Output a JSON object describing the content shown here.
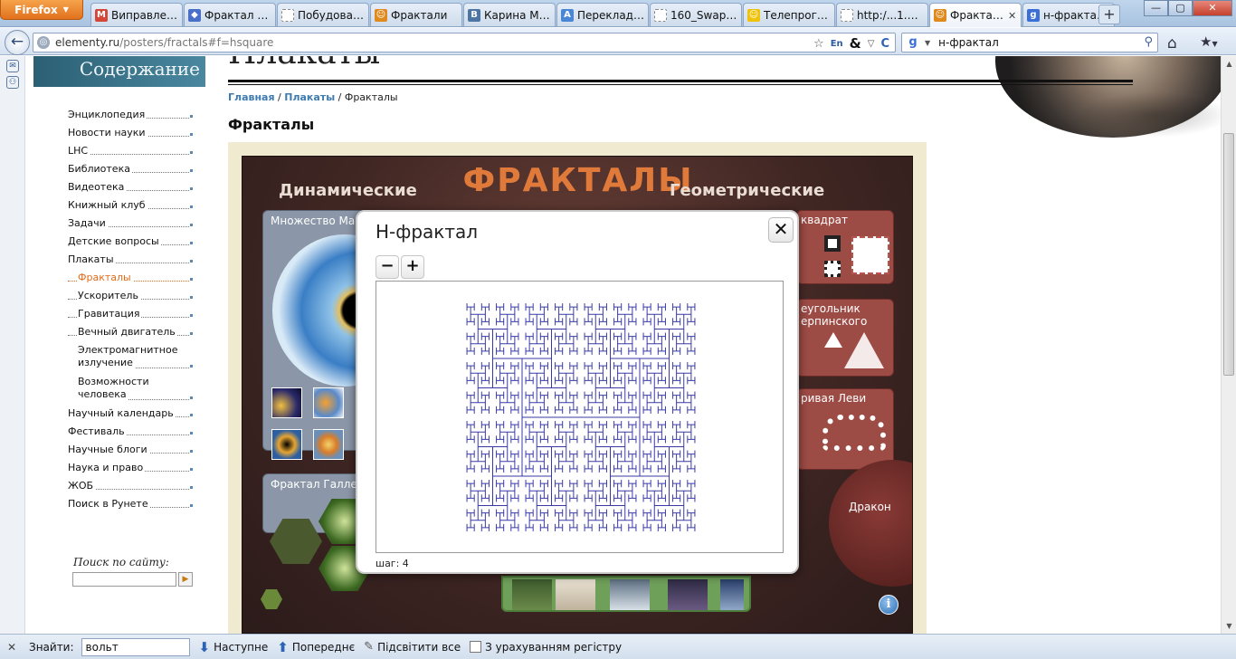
{
  "browser": {
    "menu_button": "Firefox",
    "tabs": [
      {
        "label": "Виправлен...",
        "fav": "M",
        "color": "#d44638"
      },
      {
        "label": "Фрактал - ...",
        "fav": "◆",
        "color": "#4a6fc9"
      },
      {
        "label": "Побудова р...",
        "fav": "",
        "color": "#ffffff"
      },
      {
        "label": "Фрактали",
        "fav": "☺",
        "color": "#e08a1e"
      },
      {
        "label": "Карина Ма...",
        "fav": "B",
        "color": "#4c75a3"
      },
      {
        "label": "Переклада...",
        "fav": "A",
        "color": "#4a86d6"
      },
      {
        "label": "160_Swapna...",
        "fav": "",
        "color": "#ffffff"
      },
      {
        "label": "Телепрогра...",
        "fav": "☺",
        "color": "#f0c20a"
      },
      {
        "label": "http:/...1.htm",
        "fav": "",
        "color": "#ffffff"
      },
      {
        "label": "Фракталы",
        "fav": "☺",
        "color": "#e08a1e",
        "active": true
      },
      {
        "label": "н-фрактал ...",
        "fav": "g",
        "color": "#3a6fd8"
      }
    ],
    "url_host": "elementy.ru",
    "url_path": "/posters/fractals#f=hsquare",
    "search_query": "н-фрактал",
    "url_icons": [
      "☆",
      "En",
      "&",
      "▽",
      "C"
    ]
  },
  "site": {
    "toc_title": "Содержание",
    "page_heading": "Плакаты",
    "breadcrumb": {
      "home": "Главная",
      "sep1": " / ",
      "posters": "Плакаты",
      "sep2": " / ",
      "current": "Фракталы"
    },
    "section_title": "Фракталы",
    "nav": [
      {
        "label": "Энциклопедия"
      },
      {
        "label": "Новости науки"
      },
      {
        "label": "LHC"
      },
      {
        "label": "Библиотека"
      },
      {
        "label": "Видеотека"
      },
      {
        "label": "Книжный клуб"
      },
      {
        "label": "Задачи"
      },
      {
        "label": "Детские вопросы"
      },
      {
        "label": "Плакаты"
      },
      {
        "label": "Фракталы",
        "sub": true,
        "active": true
      },
      {
        "label": "Ускоритель",
        "sub": true
      },
      {
        "label": "Гравитация",
        "sub": true
      },
      {
        "label": "Вечный двигатель",
        "sub": true
      },
      {
        "label": "Электромагнитное излучение",
        "sub": true,
        "two": true
      },
      {
        "label": "Возможности человека",
        "sub": true,
        "two": true
      },
      {
        "label": "Научный календарь"
      },
      {
        "label": "Фестиваль"
      },
      {
        "label": "Научные блоги"
      },
      {
        "label": "Наука и право"
      },
      {
        "label": "ЖОБ"
      },
      {
        "label": "Поиск в Рунете"
      }
    ],
    "site_search_label": "Поиск по сайту:"
  },
  "poster": {
    "title": "ФРАКТАЛЫ",
    "dynamic_label": "Динамические",
    "geometric_label": "Геометрические",
    "mandelbrot_label": "Множество Ман",
    "gallery_label": "Фрактал Галлея",
    "square_label": "квадрат",
    "triangle_label": "еугольник\nерпинского",
    "levy_label": "ривая Леви",
    "dragon_label": "Дракон",
    "info_icon": "i"
  },
  "dialog": {
    "title": "Н-фрактал",
    "close": "✕",
    "zoom_out": "−",
    "zoom_in": "+",
    "step_label": "шаг: 4",
    "fractal_step": 4,
    "line_color": "#3a3aa6"
  },
  "findbar": {
    "close": "✕",
    "label": "Знайти:",
    "query": "вольт",
    "next": "Наступне",
    "prev": "Попереднє",
    "highlight": "Підсвітити все",
    "match_case": "З урахуванням регістру"
  }
}
